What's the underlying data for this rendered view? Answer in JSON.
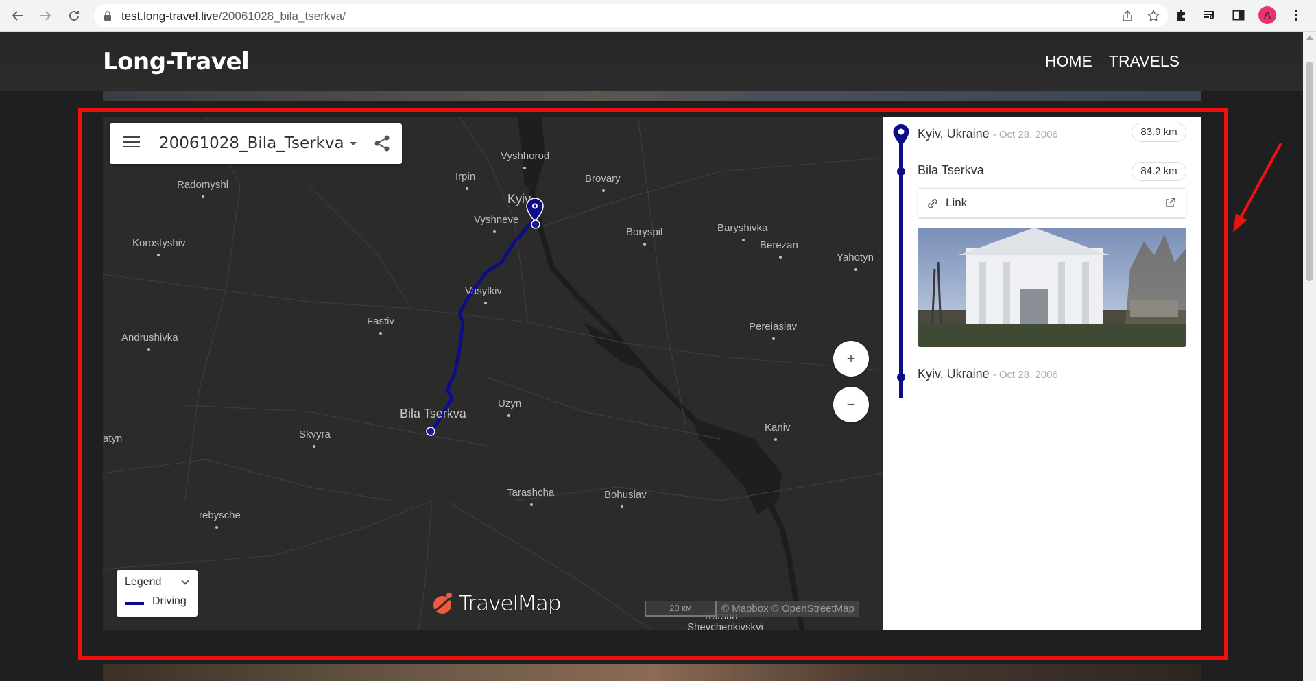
{
  "browser": {
    "url_host": "test.long-travel.live",
    "url_path": "/20061028_bila_tserkva/",
    "avatar_letter": "A"
  },
  "site": {
    "brand": "Long-Travel",
    "nav": [
      "HOME",
      "TRAVELS"
    ]
  },
  "map": {
    "title": "20061028_Bila_Tserkva",
    "places": [
      {
        "name": "Vyshhorod",
        "size": "normal"
      },
      {
        "name": "Irpin",
        "size": "normal"
      },
      {
        "name": "Brovary",
        "size": "normal"
      },
      {
        "name": "Radomyshl",
        "size": "normal"
      },
      {
        "name": "Kyiv",
        "size": "big"
      },
      {
        "name": "Vyshneve",
        "size": "normal"
      },
      {
        "name": "Boryspil",
        "size": "normal"
      },
      {
        "name": "Baryshivka",
        "size": "normal"
      },
      {
        "name": "Korostyshiv",
        "size": "normal"
      },
      {
        "name": "Berezan",
        "size": "normal"
      },
      {
        "name": "Yahotyn",
        "size": "normal"
      },
      {
        "name": "Vasylkiv",
        "size": "normal"
      },
      {
        "name": "Fastiv",
        "size": "normal"
      },
      {
        "name": "Andrushivka",
        "size": "normal"
      },
      {
        "name": "Pereiaslav",
        "size": "normal"
      },
      {
        "name": "Uzyn",
        "size": "normal"
      },
      {
        "name": "Bila Tserkva",
        "size": "big"
      },
      {
        "name": "Skvyra",
        "size": "normal"
      },
      {
        "name": "atyn",
        "size": "normal"
      },
      {
        "name": "Kaniv",
        "size": "normal"
      },
      {
        "name": "Tarashcha",
        "size": "normal"
      },
      {
        "name": "Bohuslav",
        "size": "normal"
      },
      {
        "name": "rebysche",
        "size": "normal"
      },
      {
        "name": "Korsun-",
        "size": "normal"
      },
      {
        "name": "Shevchenkivskyi",
        "size": "normal"
      }
    ],
    "zoom_in": "+",
    "zoom_out": "−",
    "legend_title": "Legend",
    "legend_item": "Driving",
    "route_color": "#0d0d8a",
    "logo_text": "TravelMap",
    "scale_label": "20 км",
    "attribution": "© Mapbox © OpenStreetMap"
  },
  "itinerary": {
    "stops": [
      {
        "name": "Kyiv, Ukraine",
        "date": "- Oct 28, 2006",
        "distance": "83.9 km"
      },
      {
        "name": "Bila Tserkva",
        "date": "",
        "distance": "84.2 km"
      },
      {
        "name": "Kyiv, Ukraine",
        "date": "- Oct 28, 2006",
        "distance": ""
      }
    ],
    "link_label": "Link"
  },
  "annotation_color": "#ee1111"
}
